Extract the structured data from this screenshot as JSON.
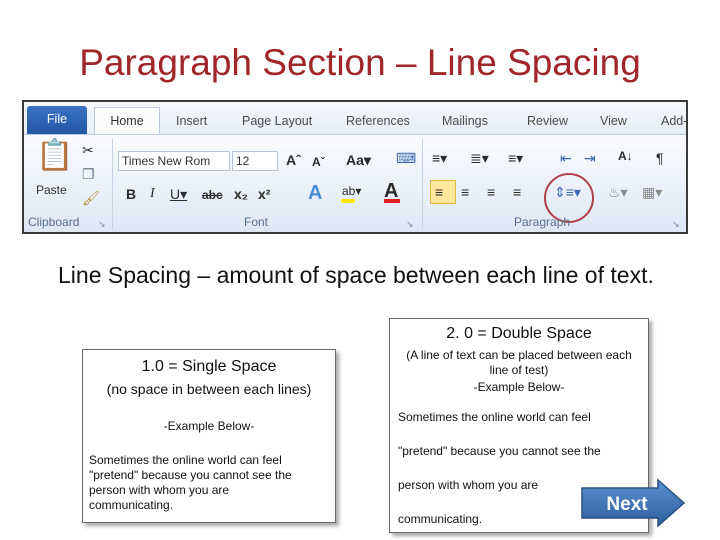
{
  "slide": {
    "title": "Paragraph Section – Line Spacing",
    "body_text": "Line Spacing – amount of space between each line of text."
  },
  "ribbon": {
    "tabs": [
      "File",
      "Home",
      "Insert",
      "Page Layout",
      "References",
      "Mailings",
      "Review",
      "View",
      "Add-"
    ],
    "font_name": "Times New Rom",
    "font_size": "12",
    "groups": {
      "clipboard": "Clipboard",
      "font": "Font",
      "paragraph": "Paragraph"
    },
    "paste_label": "Paste"
  },
  "single_box": {
    "heading": "1.0 = Single Space",
    "subheading": "(no space in between each lines)",
    "example_label": "-Example Below-",
    "lines": [
      "Sometimes the online world can feel",
      "\"pretend\" because you cannot see the",
      "person with whom you are",
      "communicating."
    ]
  },
  "double_box": {
    "heading": "2. 0 = Double Space",
    "note_line1": "(A line of text can be placed between each",
    "note_line2": "line of test)",
    "example_label": "-Example Below-",
    "lines": [
      "Sometimes the online world can feel",
      "\"pretend\" because you cannot see the",
      "person with whom you are",
      "communicating."
    ]
  },
  "next_button": {
    "label": "Next"
  },
  "colors": {
    "title": "#a0262a",
    "file_tab": "#2457a5",
    "next_button": "#3f77b4",
    "highlight_circle": "#b2404a"
  }
}
